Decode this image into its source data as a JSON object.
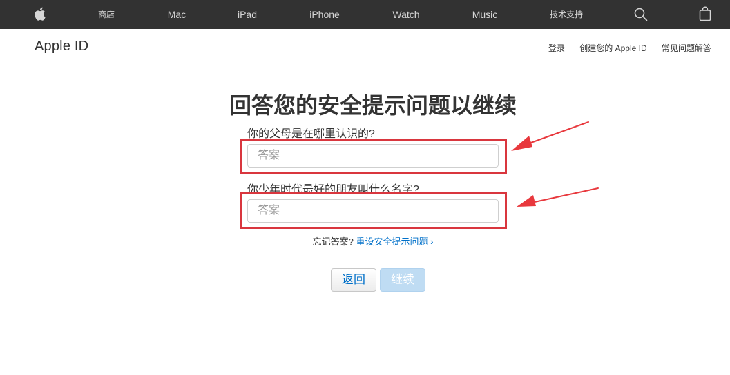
{
  "nav": {
    "store": "商店",
    "mac": "Mac",
    "ipad": "iPad",
    "iphone": "iPhone",
    "watch": "Watch",
    "music": "Music",
    "support": "技术支持"
  },
  "header": {
    "title": "Apple ID",
    "signin": "登录",
    "create": "创建您的 Apple ID",
    "faq": "常见问题解答"
  },
  "main": {
    "title": "回答您的安全提示问题以继续",
    "questions": [
      {
        "label": "你的父母是在哪里认识的?",
        "placeholder": "答案",
        "value": ""
      },
      {
        "label": "你少年时代最好的朋友叫什么名字?",
        "placeholder": "答案",
        "value": ""
      }
    ],
    "forgot_text": "忘记答案?",
    "reset_link": "重设安全提示问题 ›",
    "back_label": "返回",
    "continue_label": "继续"
  },
  "colors": {
    "nav_bg": "#323232",
    "link": "#0070c9",
    "highlight": "#d9363e",
    "continue_disabled": "#bfdcf3"
  },
  "icons": [
    "apple-logo-icon",
    "search-icon",
    "shopping-bag-icon",
    "arrow-annotation"
  ]
}
